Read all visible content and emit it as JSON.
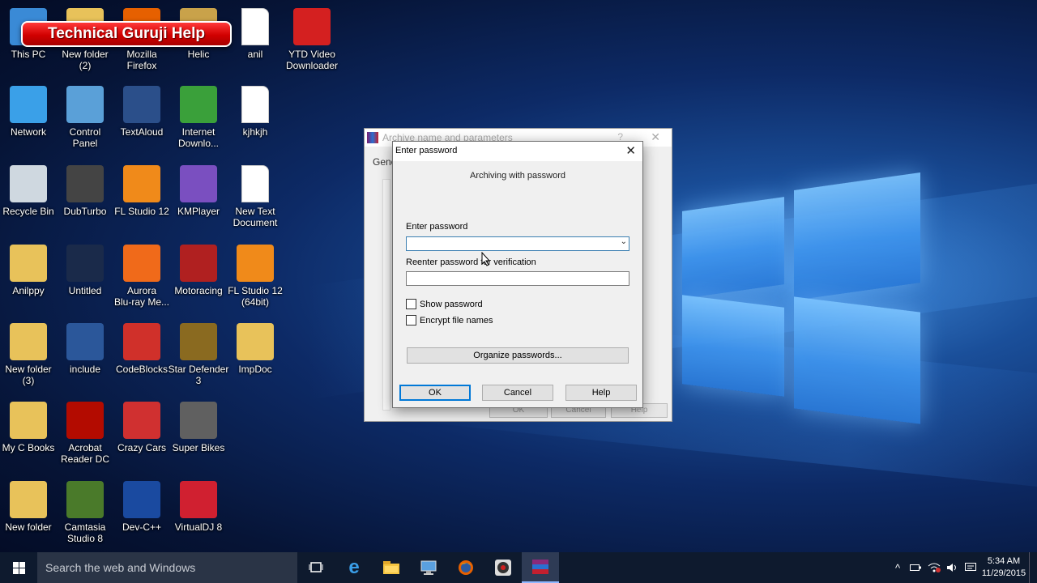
{
  "banner": "Technical Guruji Help",
  "desktop_icons": [
    {
      "label": "This PC",
      "icon": "computer-icon",
      "color": "#3a8ad6"
    },
    {
      "label": "New folder\n(2)",
      "icon": "folder-icon",
      "color": "#e8c25a"
    },
    {
      "label": "Mozilla\nFirefox",
      "icon": "firefox-icon",
      "color": "#e66000"
    },
    {
      "label": "Helic",
      "icon": "folder-icon",
      "color": "#c9a24a"
    },
    {
      "label": "anil",
      "icon": "document-icon",
      "color": "#ffffff"
    },
    {
      "label": "YTD Video\nDownloader",
      "icon": "ytd-icon",
      "color": "#d42020"
    },
    {
      "label": "Network",
      "icon": "network-icon",
      "color": "#3aa0e8"
    },
    {
      "label": "Control\nPanel",
      "icon": "control-panel-icon",
      "color": "#5aa0d8"
    },
    {
      "label": "TextAloud",
      "icon": "textaloud-icon",
      "color": "#2b4f8a"
    },
    {
      "label": "Internet\nDownlo...",
      "icon": "idm-icon",
      "color": "#3aa03a"
    },
    {
      "label": "kjhkjh",
      "icon": "document-icon",
      "color": "#ffffff"
    },
    {
      "label": "Recycle Bin",
      "icon": "recycle-bin-icon",
      "color": "#cfd8e0"
    },
    {
      "label": "DubTurbo",
      "icon": "dubturbo-icon",
      "color": "#444444"
    },
    {
      "label": "FL Studio 12",
      "icon": "fl-studio-icon",
      "color": "#f08a1a"
    },
    {
      "label": "KMPlayer",
      "icon": "kmplayer-icon",
      "color": "#7a4fc0"
    },
    {
      "label": "New Text\nDocument",
      "icon": "document-icon",
      "color": "#ffffff"
    },
    {
      "label": "Anilppy",
      "icon": "user-folder-icon",
      "color": "#e8c25a"
    },
    {
      "label": "Untitled",
      "icon": "video-icon",
      "color": "#1a2a4a"
    },
    {
      "label": "Aurora\nBlu-ray Me...",
      "icon": "aurora-icon",
      "color": "#f06a1a"
    },
    {
      "label": "Motoracing",
      "icon": "motoracing-icon",
      "color": "#b02020"
    },
    {
      "label": "FL Studio 12\n(64bit)",
      "icon": "fl-studio-icon",
      "color": "#f08a1a"
    },
    {
      "label": "New folder\n(3)",
      "icon": "folder-icon",
      "color": "#e8c25a"
    },
    {
      "label": "include",
      "icon": "word-icon",
      "color": "#2b579a"
    },
    {
      "label": "CodeBlocks",
      "icon": "codeblocks-icon",
      "color": "#d0302a"
    },
    {
      "label": "Star Defender\n3",
      "icon": "star-defender-icon",
      "color": "#8a6a20"
    },
    {
      "label": "ImpDoc",
      "icon": "folder-icon",
      "color": "#e8c25a"
    },
    {
      "label": "My C Books",
      "icon": "pdf-folder-icon",
      "color": "#e8c25a"
    },
    {
      "label": "Acrobat\nReader DC",
      "icon": "acrobat-icon",
      "color": "#b30b00"
    },
    {
      "label": "Crazy Cars",
      "icon": "crazy-cars-icon",
      "color": "#d03030"
    },
    {
      "label": "Super Bikes",
      "icon": "super-bikes-icon",
      "color": "#606060"
    },
    {
      "label": "New folder",
      "icon": "folder-icon",
      "color": "#e8c25a"
    },
    {
      "label": "Camtasia\nStudio 8",
      "icon": "camtasia-icon",
      "color": "#4a7a2a"
    },
    {
      "label": "Dev-C++",
      "icon": "devcpp-icon",
      "color": "#1a4aa0"
    },
    {
      "label": "VirtualDJ 8",
      "icon": "virtualdj-icon",
      "color": "#d02030"
    }
  ],
  "bg_dialog": {
    "title": "Archive name and parameters",
    "help": "?",
    "close": "✕",
    "tab": "Gene",
    "buttons": [
      "OK",
      "Cancel",
      "Help"
    ]
  },
  "dialog": {
    "title": "Enter password",
    "subtitle": "Archiving with password",
    "enter_label": "Enter password",
    "enter_value": "",
    "reenter_label": "Reenter password for verification",
    "reenter_value": "",
    "show_password": "Show password",
    "encrypt_names": "Encrypt file names",
    "organize": "Organize passwords...",
    "ok": "OK",
    "cancel": "Cancel",
    "help": "Help"
  },
  "taskbar": {
    "search_placeholder": "Search the web and Windows",
    "time": "5:34 AM",
    "date": "11/29/2015"
  }
}
